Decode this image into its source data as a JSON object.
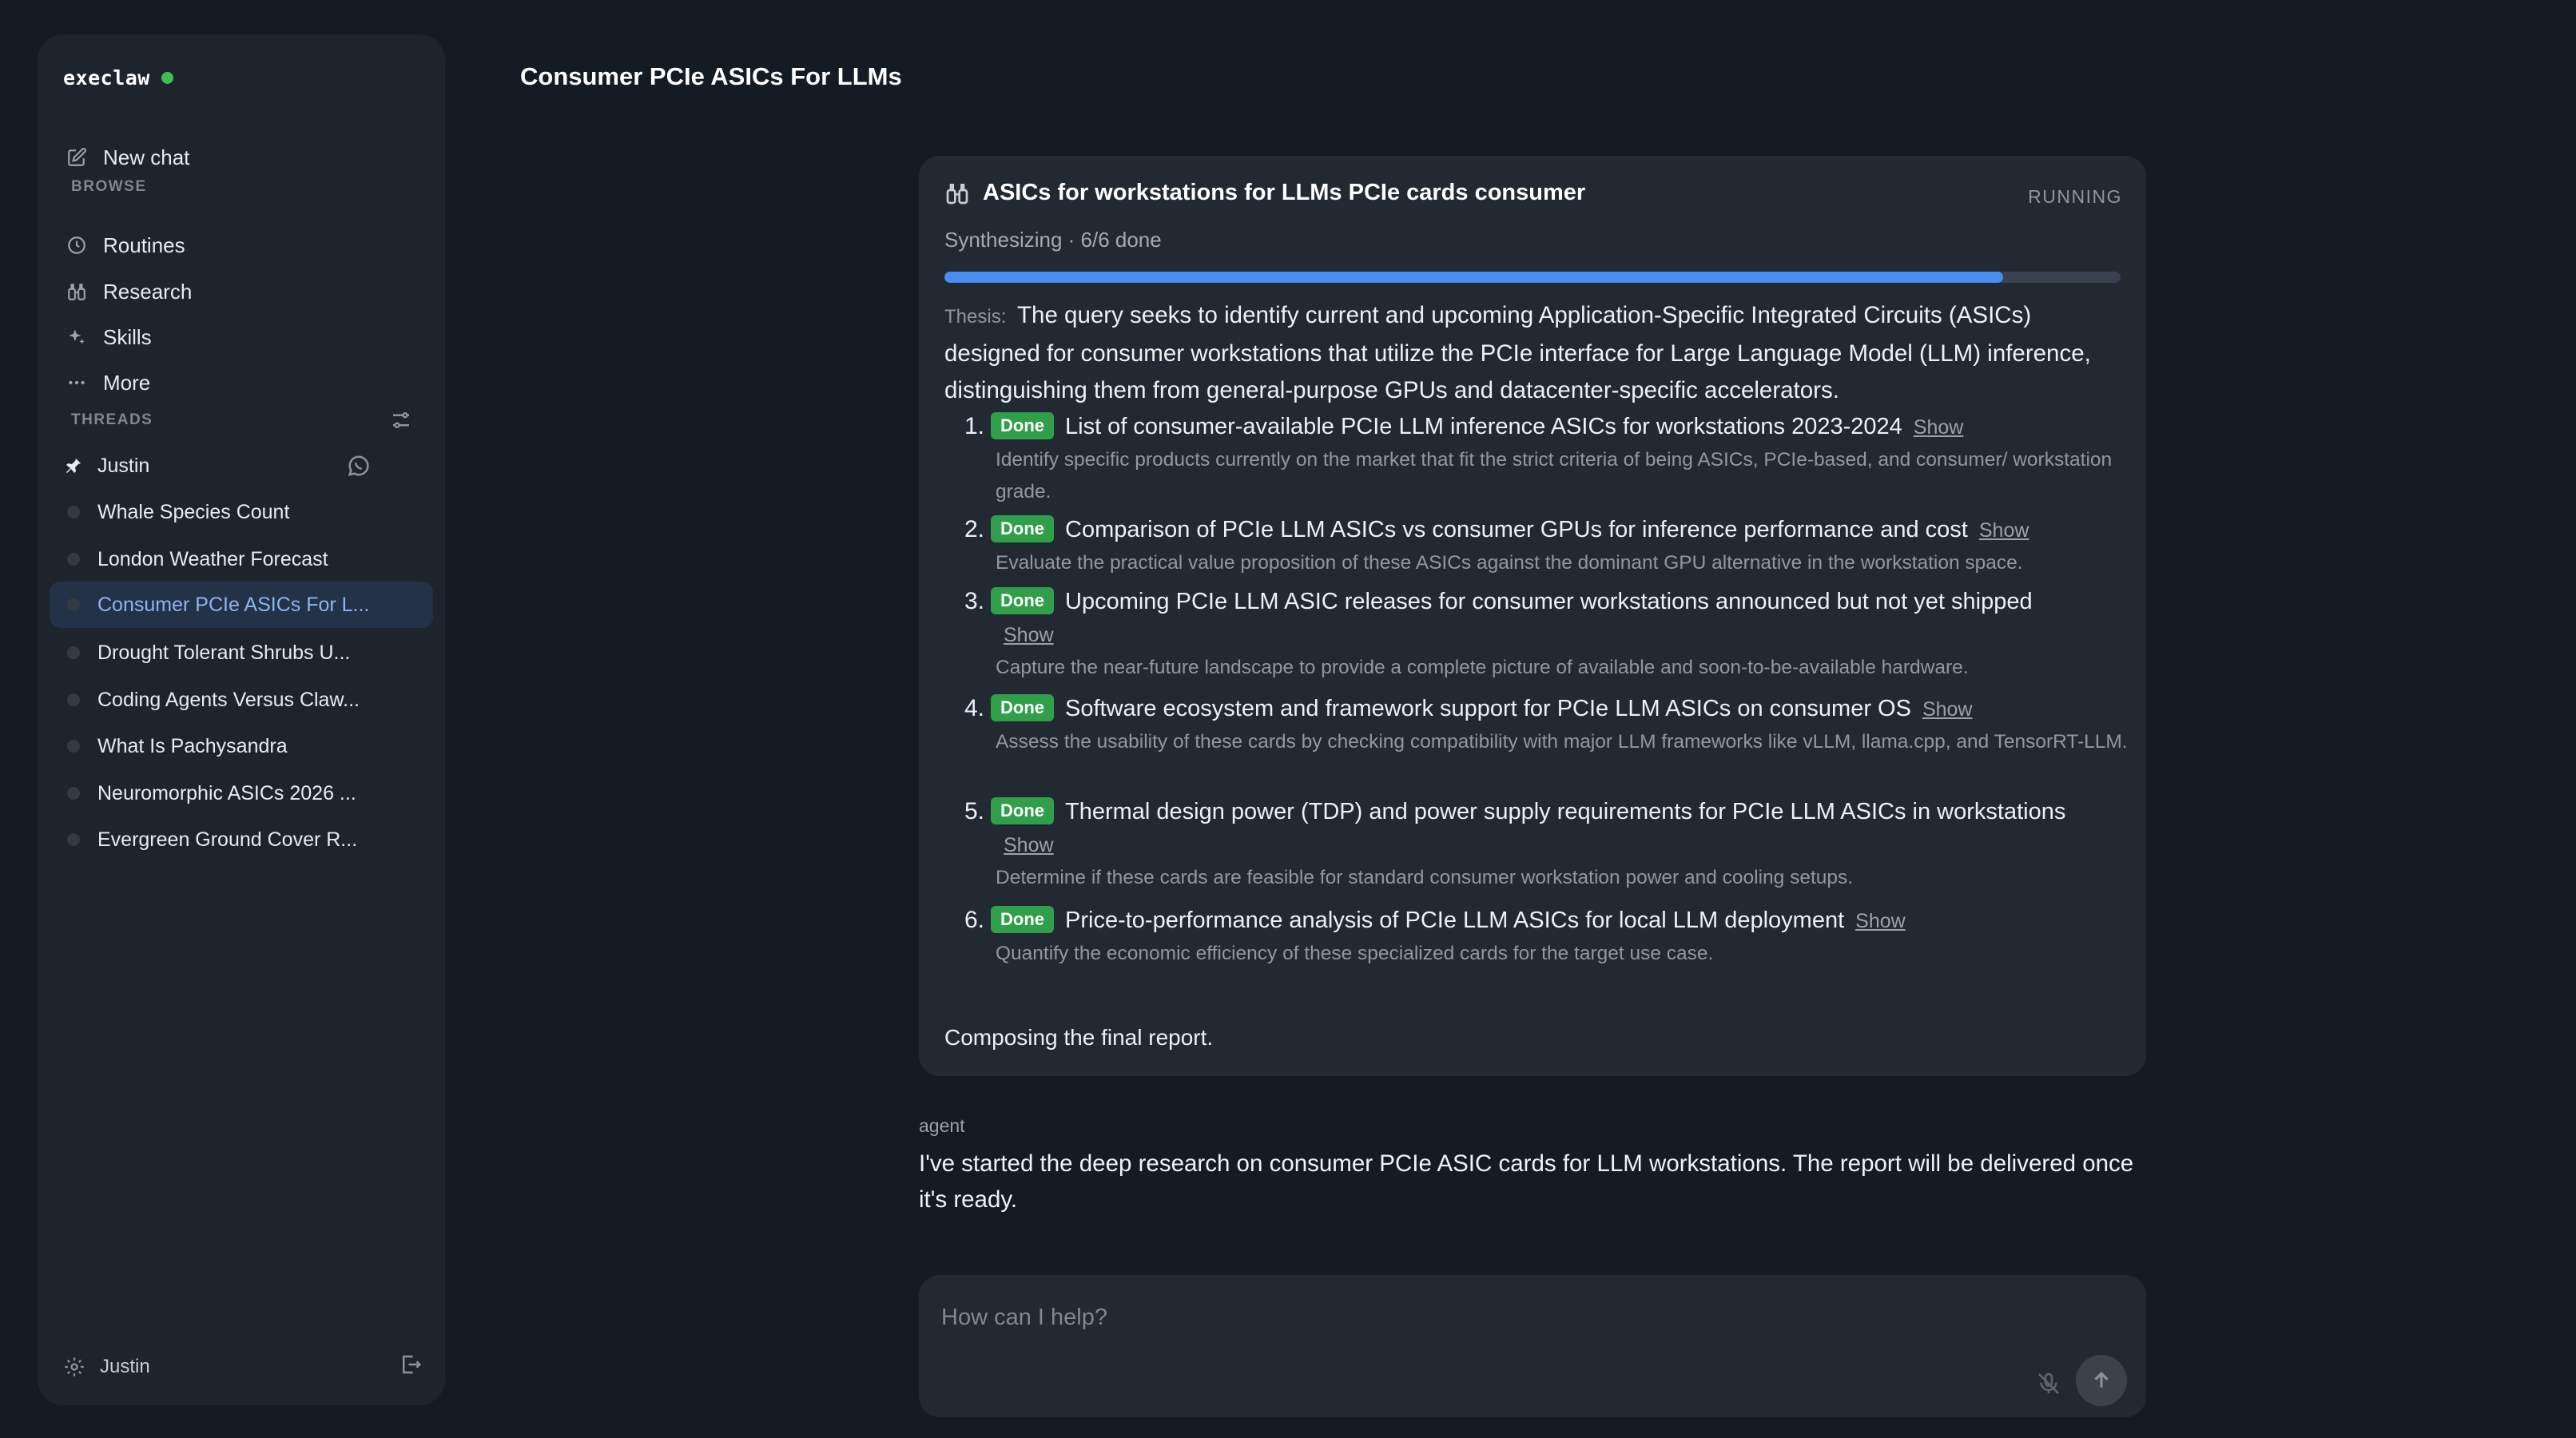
{
  "sidebar": {
    "brand": "execlaw",
    "new_chat": "New chat",
    "browse_label": "BROWSE",
    "browse_items": [
      {
        "label": "Routines",
        "icon": "clock-icon"
      },
      {
        "label": "Research",
        "icon": "binoculars-icon"
      },
      {
        "label": "Skills",
        "icon": "sparkle-icon"
      },
      {
        "label": "More",
        "icon": "ellipsis-icon"
      }
    ],
    "threads_label": "THREADS",
    "threads": [
      {
        "label": "Justin",
        "pinned": true
      },
      {
        "label": "Whale Species Count"
      },
      {
        "label": "London Weather Forecast"
      },
      {
        "label": "Consumer PCIe ASICs For L...",
        "active": true
      },
      {
        "label": "Drought Tolerant Shrubs U..."
      },
      {
        "label": "Coding Agents Versus Claw..."
      },
      {
        "label": "What Is Pachysandra"
      },
      {
        "label": "Neuromorphic ASICs 2026 ..."
      },
      {
        "label": "Evergreen Ground Cover R..."
      }
    ],
    "footer_user": "Justin"
  },
  "main": {
    "title": "Consumer PCIe ASICs For LLMs",
    "research_card": {
      "title": "ASICs for workstations for LLMs PCIe cards consumer",
      "status": "RUNNING",
      "progress_text": "Synthesizing  · 6/6 done",
      "progress_fraction": 0.9,
      "thesis_label": "Thesis:",
      "thesis": "The query seeks to identify current and upcoming Application-Specific Integrated Circuits (ASICs) designed for consumer workstations that utilize the PCIe interface for Large Language Model (LLM) inference, distinguishing them from general-purpose GPUs and datacenter-specific accelerators.",
      "done_label": "Done",
      "show_label": "Show",
      "steps": [
        {
          "num": "1.",
          "title": "List of consumer-available PCIe LLM inference ASICs for workstations 2023-2024",
          "desc": "Identify specific products currently on the market that fit the strict criteria of being ASICs, PCIe-based, and consumer/ workstation grade."
        },
        {
          "num": "2.",
          "title": "Comparison of PCIe LLM ASICs vs consumer GPUs for inference performance and cost",
          "desc": "Evaluate the practical value proposition of these ASICs against the dominant GPU alternative in the workstation space."
        },
        {
          "num": "3.",
          "title": "Upcoming PCIe LLM ASIC releases for consumer workstations announced but not yet shipped",
          "desc": "Capture the near-future landscape to provide a complete picture of available and soon-to-be-available hardware."
        },
        {
          "num": "4.",
          "title": "Software ecosystem and framework support for PCIe LLM ASICs on consumer OS",
          "desc": "Assess the usability of these cards by checking compatibility with major LLM frameworks like vLLM, llama.cpp, and TensorRT-LLM."
        },
        {
          "num": "5.",
          "title": "Thermal design power (TDP) and power supply requirements for PCIe LLM ASICs in workstations",
          "desc": "Determine if these cards are feasible for standard consumer workstation power and cooling setups."
        },
        {
          "num": "6.",
          "title": "Price-to-performance analysis of PCIe LLM ASICs for local LLM deployment",
          "desc": "Quantify the economic efficiency of these specialized cards for the target use case."
        }
      ],
      "composing": "Composing the final report."
    },
    "agent_label": "agent",
    "agent_message": "I've started the deep research on consumer PCIe ASIC cards for LLM workstations. The report will be delivered once it's ready.",
    "composer": {
      "placeholder": "How can I help?"
    }
  },
  "colors": {
    "accent": "#4a8df0",
    "done": "#2f9f49",
    "online": "#3fbe52"
  }
}
